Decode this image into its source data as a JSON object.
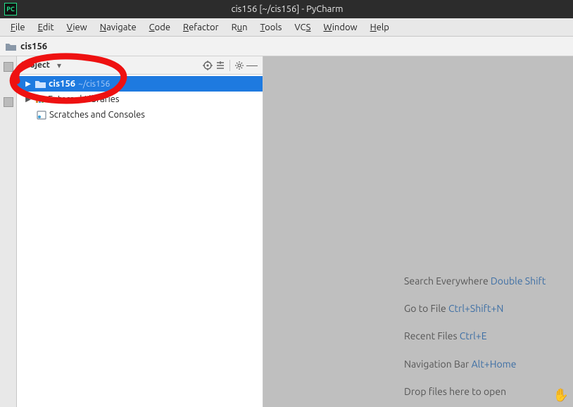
{
  "window": {
    "title": "cis156 [~/cis156] - PyCharm"
  },
  "menu": {
    "file": "File",
    "edit": "Edit",
    "view": "View",
    "navigate": "Navigate",
    "code": "Code",
    "refactor": "Refactor",
    "run": "Run",
    "tools": "Tools",
    "vcs": "VCS",
    "window": "Window",
    "help": "Help"
  },
  "breadcrumb": {
    "root": "cis156"
  },
  "toolwindow": {
    "title": "Project",
    "tree": {
      "root_name": "cis156",
      "root_path": "~/cis156",
      "external_libs": "External Libraries",
      "scratches": "Scratches and Consoles"
    }
  },
  "hints": {
    "search_label": "Search Everywhere",
    "search_key": "Double Shift",
    "goto_label": "Go to File",
    "goto_key": "Ctrl+Shift+N",
    "recent_label": "Recent Files",
    "recent_key": "Ctrl+E",
    "navbar_label": "Navigation Bar",
    "navbar_key": "Alt+Home",
    "drop_label": "Drop files here to open"
  }
}
